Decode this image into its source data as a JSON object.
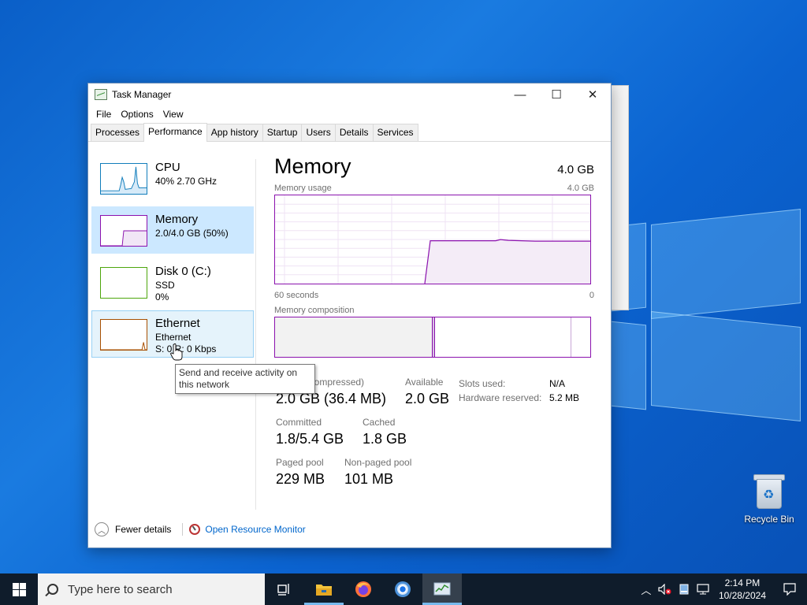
{
  "window": {
    "title": "Task Manager",
    "controls": {
      "minimize": "—",
      "maximize": "☐",
      "close": "✕"
    }
  },
  "menu": [
    "File",
    "Options",
    "View"
  ],
  "tabs": [
    "Processes",
    "Performance",
    "App history",
    "Startup",
    "Users",
    "Details",
    "Services"
  ],
  "active_tab": "Performance",
  "sidebar": {
    "items": [
      {
        "title": "CPU",
        "line1": "40% 2.70 GHz",
        "line2": "",
        "color": "#117dbb"
      },
      {
        "title": "Memory",
        "line1": "2.0/4.0 GB (50%)",
        "line2": "",
        "color": "#8b12ae"
      },
      {
        "title": "Disk 0 (C:)",
        "line1": "SSD",
        "line2": "0%",
        "color": "#4da60c"
      },
      {
        "title": "Ethernet",
        "line1": "Ethernet",
        "line2": "S: 0 R: 0 Kbps",
        "color": "#a74f01"
      }
    ]
  },
  "memory": {
    "title": "Memory",
    "total": "4.0 GB",
    "usage_label": "Memory usage",
    "usage_max": "4.0 GB",
    "time_left": "60 seconds",
    "time_right": "0",
    "composition_label": "Memory composition",
    "accent": "#8b12ae",
    "graph_level": 0.49,
    "stats": {
      "in_use_label": "In use (Compressed)",
      "in_use_value": "2.0 GB (36.4 MB)",
      "available_label": "Available",
      "available_value": "2.0 GB",
      "committed_label": "Committed",
      "committed_value": "1.8/5.4 GB",
      "cached_label": "Cached",
      "cached_value": "1.8 GB",
      "paged_label": "Paged pool",
      "paged_value": "229 MB",
      "nonpaged_label": "Non-paged pool",
      "nonpaged_value": "101 MB",
      "slots_label": "Slots used:",
      "slots_value": "N/A",
      "hwres_label": "Hardware reserved:",
      "hwres_value": "5.2 MB"
    }
  },
  "footer": {
    "fewer_details": "Fewer details",
    "resource_monitor": "Open Resource Monitor"
  },
  "tooltip": "Send and receive activity on this network",
  "desktop": {
    "recycle_bin": "Recycle Bin"
  },
  "taskbar": {
    "search_placeholder": "Type here to search",
    "time": "2:14 PM",
    "date": "10/28/2024"
  }
}
